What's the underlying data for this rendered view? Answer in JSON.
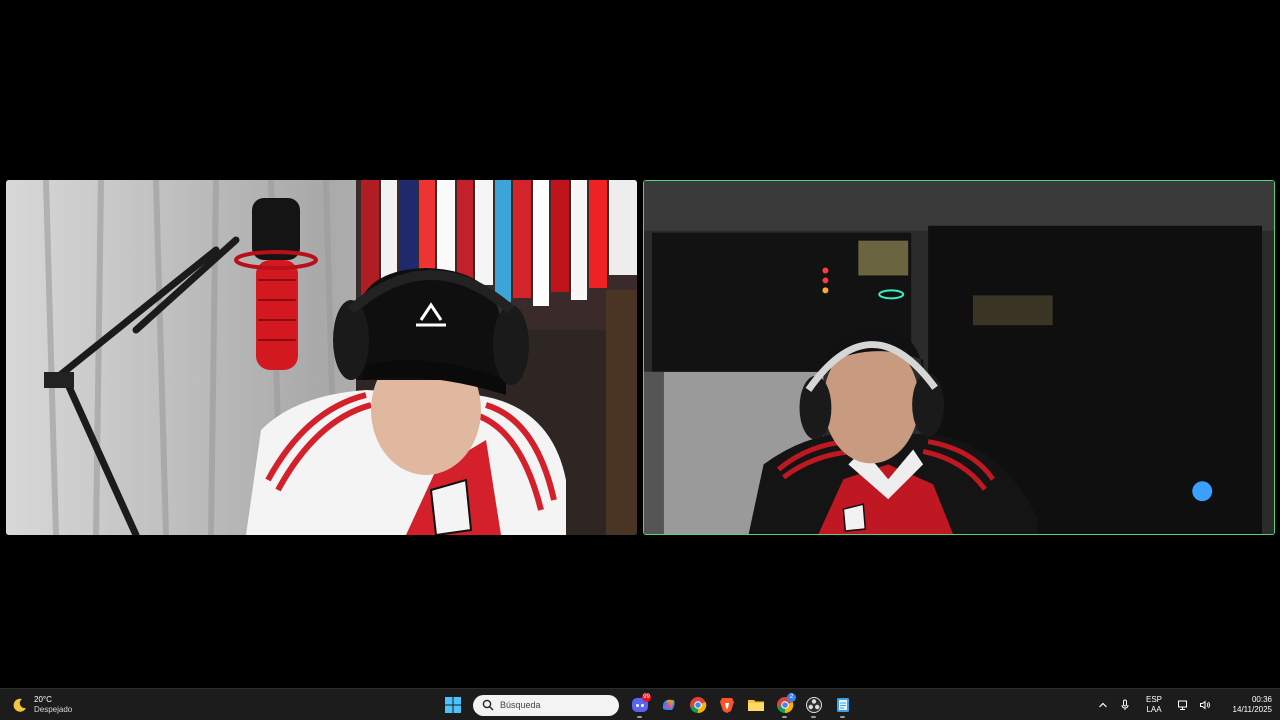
{
  "call": {
    "participants": [
      {
        "tile": "left",
        "active_speaker": false
      },
      {
        "tile": "right",
        "active_speaker": true
      }
    ],
    "colors": {
      "active_border": "#4fd67a",
      "background": "#000000"
    }
  },
  "taskbar": {
    "weather": {
      "temperature": "20°C",
      "condition": "Despejado",
      "icon": "moon-icon"
    },
    "search": {
      "placeholder": "Búsqueda"
    },
    "apps": [
      {
        "name": "discord",
        "icon": "discord-icon",
        "badge": "99"
      },
      {
        "name": "copilot",
        "icon": "copilot-icon"
      },
      {
        "name": "chrome",
        "icon": "chrome-icon"
      },
      {
        "name": "brave",
        "icon": "brave-icon"
      },
      {
        "name": "file-explorer",
        "icon": "folder-icon"
      },
      {
        "name": "chrome-profile",
        "icon": "chrome-icon",
        "badge": "2"
      },
      {
        "name": "obs",
        "icon": "obs-icon"
      },
      {
        "name": "notepad",
        "icon": "notepad-icon"
      }
    ],
    "tray": {
      "language": "ESP",
      "layout": "LAA",
      "time": "00:36",
      "date": "14/11/2025"
    }
  }
}
